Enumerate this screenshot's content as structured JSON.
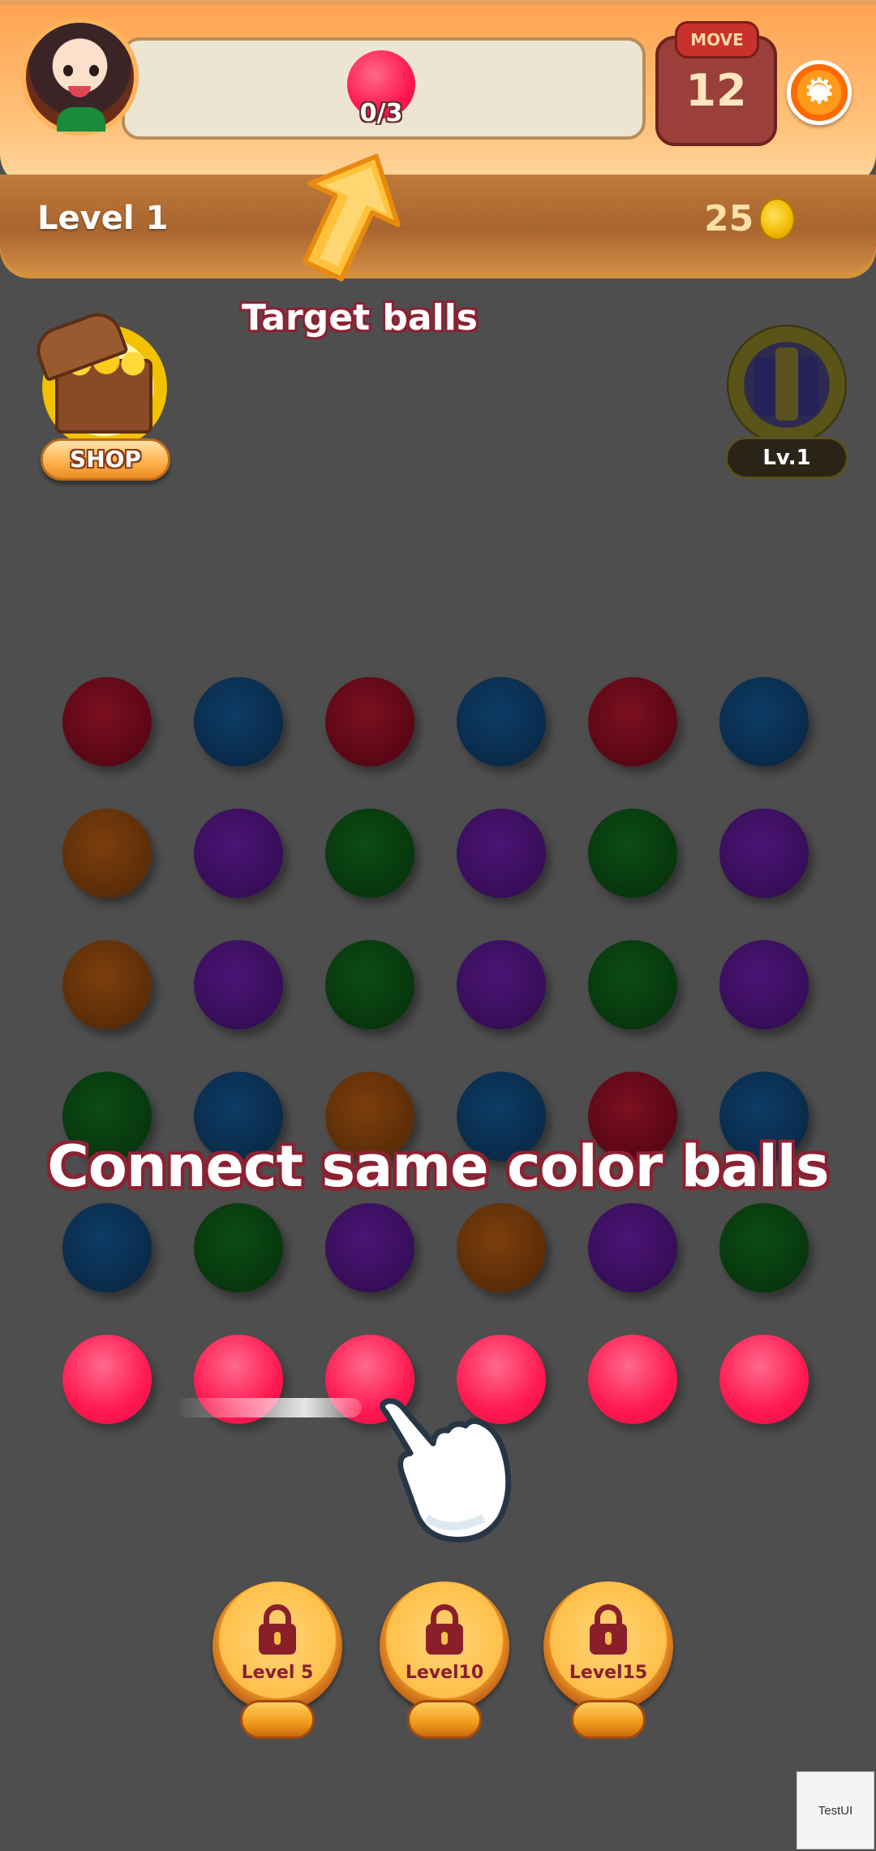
{
  "header": {
    "target_count": "0/3",
    "move_label": "MOVE",
    "moves_left": "12",
    "level_label": "Level 1",
    "coins": "25",
    "settings_icon": "gear-icon"
  },
  "side": {
    "shop_label": "SHOP",
    "gift_level_label": "Lv.1"
  },
  "hints": {
    "target_label": "Target balls",
    "connect_label": "Connect same color balls"
  },
  "colors": {
    "target": "#ff1850",
    "dim_red": "#5c0716",
    "dim_blue": "#0a2c4c",
    "dim_brown": "#5e2e08",
    "dim_purple": "#380e5a",
    "dim_green": "#08380e"
  },
  "board": {
    "rows": [
      [
        "dim-red",
        "dim-blue",
        "dim-red",
        "dim-blue",
        "dim-red",
        "dim-blue"
      ],
      [
        "dim-brown",
        "dim-purple",
        "dim-green",
        "dim-purple",
        "dim-green",
        "dim-purple"
      ],
      [
        "dim-brown",
        "dim-purple",
        "dim-green",
        "dim-purple",
        "dim-green",
        "dim-purple"
      ],
      [
        "dim-green",
        "dim-blue",
        "dim-brown",
        "dim-blue",
        "dim-red",
        "dim-blue"
      ],
      [
        "dim-blue",
        "dim-green",
        "dim-purple",
        "dim-brown",
        "dim-purple",
        "dim-green"
      ],
      [
        "pink",
        "pink",
        "pink",
        "pink",
        "pink",
        "pink"
      ]
    ]
  },
  "level_unlocks": [
    {
      "label": "Level  5"
    },
    {
      "label": "Level10"
    },
    {
      "label": "Level15"
    }
  ],
  "debug": {
    "test_ui_label": "TestUI"
  }
}
